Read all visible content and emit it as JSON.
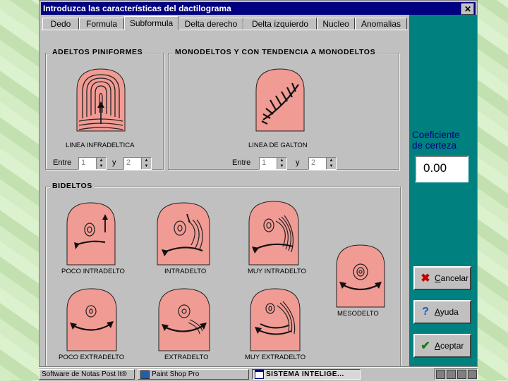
{
  "window": {
    "title": "Introduzca las características del dactilograma",
    "close_label": "✕"
  },
  "tabs": [
    {
      "label": "Dedo"
    },
    {
      "label": "Formula"
    },
    {
      "label": "Subformula"
    },
    {
      "label": "Delta derecho"
    },
    {
      "label": "Delta izquierdo"
    },
    {
      "label": "Nucleo"
    },
    {
      "label": "Anomalias"
    }
  ],
  "active_tab": "Subformula",
  "groups": {
    "adeltos": {
      "title": "ADELTOS PINIFORMES",
      "caption": "LINEA INFRADELTICA",
      "entre_label": "Entre",
      "y_label": "y",
      "from": "1",
      "to": "2"
    },
    "monodeltos": {
      "title": "MONODELTOS Y CON TENDENCIA A MONODELTOS",
      "caption": "LINEA DE GALTON",
      "entre_label": "Entre",
      "y_label": "y",
      "from": "1",
      "to": "2"
    },
    "bideltos": {
      "title": "BIDELTOS",
      "items": [
        {
          "caption": "POCO INTRADELTO"
        },
        {
          "caption": "INTRADELTO"
        },
        {
          "caption": "MUY INTRADELTO"
        },
        {
          "caption": "MESODELTO"
        },
        {
          "caption": "POCO EXTRADELTO"
        },
        {
          "caption": "EXTRADELTO"
        },
        {
          "caption": "MUY EXTRADELTO"
        }
      ]
    }
  },
  "certainty": {
    "label_line1": "Coeficiente",
    "label_line2": "de certeza",
    "value": "0.00"
  },
  "buttons": {
    "cancel": {
      "label": "Cancelar",
      "icon": "x-icon"
    },
    "help": {
      "label": "Ayuda",
      "icon": "question-icon"
    },
    "ok": {
      "label": "Aceptar",
      "icon": "checkmark-icon"
    }
  },
  "taskbar": {
    "tasks": [
      {
        "label": "Software de Notas Post It®"
      },
      {
        "label": "Paint Shop Pro"
      },
      {
        "label": "SISTEMA INTELIGE..."
      }
    ]
  },
  "colors": {
    "finger_fill": "#f09b94",
    "title_bar": "#000080",
    "side_panel": "#00807f",
    "accent_text": "#000080",
    "background_pattern": "#c8e6b4"
  }
}
